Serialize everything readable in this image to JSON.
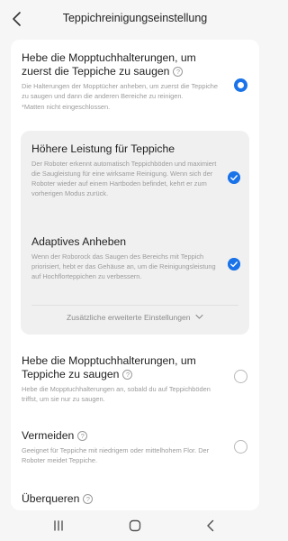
{
  "header": {
    "title": "Teppichreinigungseinstellung"
  },
  "options": {
    "lift_first": {
      "title": "Hebe die Mopptuchhalterungen, um zuerst die Teppiche zu saugen",
      "description": "Die Halterungen der Mopptücher anheben, um zuerst die Teppiche zu saugen und dann die anderen Bereiche zu reinigen.",
      "note": "*Matten nicht eingeschlossen.",
      "selected": true
    },
    "higher_power": {
      "title": "Höhere Leistung für Teppiche",
      "description": "Der Roboter erkennt automatisch Teppichböden und maximiert die Saugleistung für eine wirksame Reinigung. Wenn sich der Roboter wieder auf einem Hartboden befindet, kehrt er zum vorherigen Modus zurück.",
      "checked": true
    },
    "adaptive_lift": {
      "title": "Adaptives Anheben",
      "description": "Wenn der Roborock das Saugen des Bereichs mit Teppich priorisiert, hebt er das Gehäuse an, um die Reinigungsleistung auf Hochflorteppichen zu verbessern.",
      "checked": true
    },
    "more_settings": "Zusätzliche erweiterte Einstellungen",
    "lift_on_carpet": {
      "title": "Hebe die Mopptuchhalterungen, um Teppiche zu saugen",
      "description": "Hebe die Mopptuchhalterungen an, sobald du auf Teppichböden triffst, um sie nur zu saugen.",
      "selected": false
    },
    "avoid": {
      "title": "Vermeiden",
      "description": "Geeignet für Teppiche mit niedrigem oder mittelhohem Flor. Der Roboter meidet Teppiche.",
      "selected": false
    },
    "cross": {
      "title": "Überqueren"
    }
  },
  "icons": {
    "back": "chevron-left-icon",
    "help": "question-circle-icon",
    "check": "checkmark-circle-icon",
    "expand": "chevron-down-icon",
    "nav_recent": "recent-apps-icon",
    "nav_home": "home-icon",
    "nav_back": "nav-back-icon"
  },
  "colors": {
    "accent": "#1a73e8",
    "background": "#f6f6f6",
    "card": "#ffffff",
    "subcard": "#f0f0f0",
    "muted_text": "#9b9b9b"
  }
}
